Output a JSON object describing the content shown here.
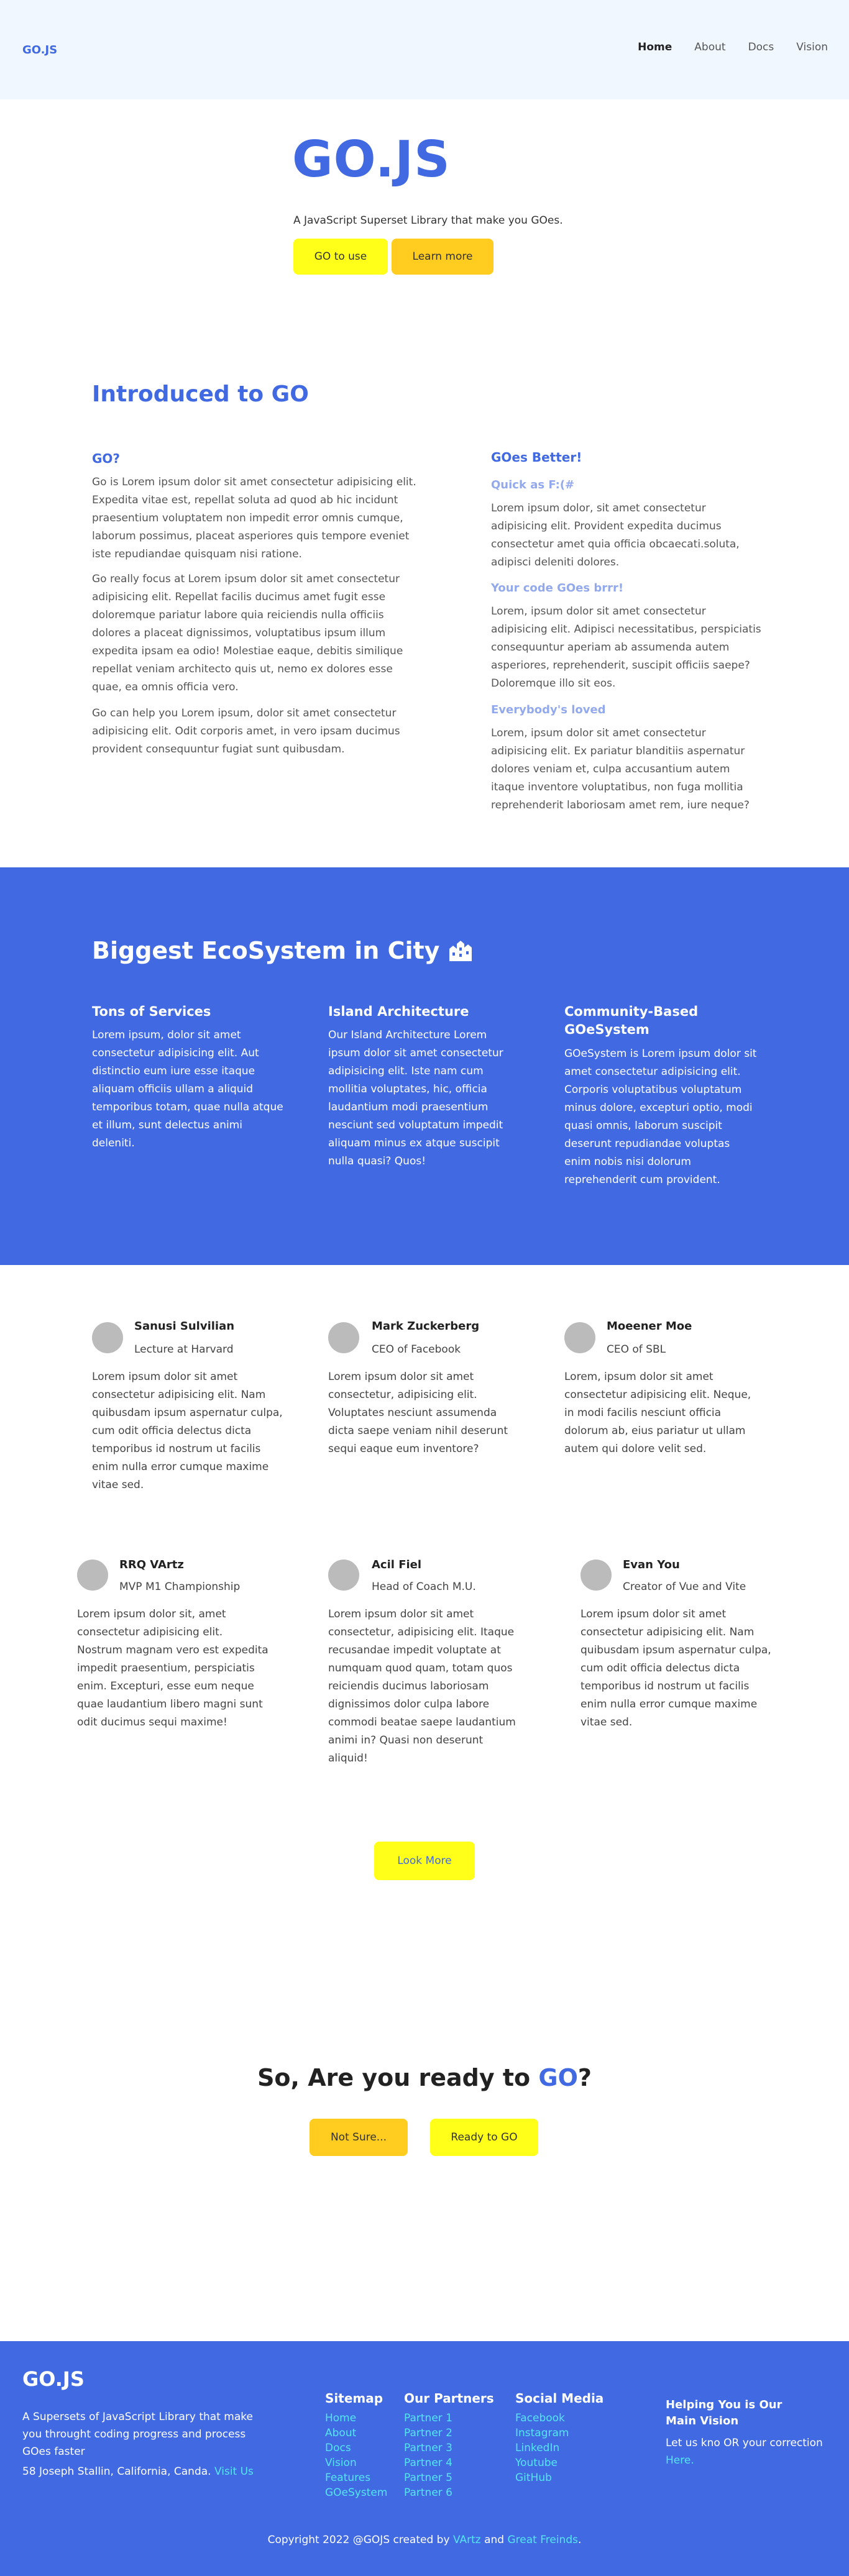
{
  "header": {
    "logo": "GO.JS",
    "nav": [
      "Home",
      "About",
      "Docs",
      "Vision"
    ]
  },
  "hero": {
    "title": "GO.JS",
    "subtitle": "A JavaScript Superset Library that make you GOes.",
    "btn_primary": "GO to use",
    "btn_secondary": "Learn more"
  },
  "intro": {
    "title": "Introduced to GO",
    "left_heading": "GO?",
    "left_paragraphs": [
      "Go is Lorem ipsum dolor sit amet consectetur adipisicing elit. Expedita vitae est, repellat soluta ad quod ab hic incidunt praesentium voluptatem non impedit error omnis cumque, laborum possimus, placeat asperiores quis tempore eveniet iste repudiandae quisquam nisi ratione.",
      "Go really focus at Lorem ipsum dolor sit amet consectetur adipisicing elit. Repellat facilis ducimus amet fugit esse doloremque pariatur labore quia reiciendis nulla officiis dolores a placeat dignissimos, voluptatibus ipsum illum expedita ipsam ea odio! Molestiae eaque, debitis similique repellat veniam architecto quis ut, nemo ex dolores esse quae, ea omnis officia vero.",
      "Go can help you Lorem ipsum, dolor sit amet consectetur adipisicing elit. Odit corporis amet, in vero ipsam ducimus provident consequuntur fugiat sunt quibusdam."
    ],
    "right_heading": "GOes Better!",
    "right_items": [
      {
        "title": "Quick as F:(#",
        "text": "Lorem ipsum dolor, sit amet consectetur adipisicing elit. Provident expedita ducimus consectetur amet quia officia obcaecati.soluta, adipisci deleniti dolores."
      },
      {
        "title": "Your code GOes brrr!",
        "text": "Lorem, ipsum dolor sit amet consectetur adipisicing elit. Adipisci necessitatibus, perspiciatis consequuntur aperiam ab assumenda autem asperiores, reprehenderit, suscipit officiis saepe? Doloremque illo sit eos."
      },
      {
        "title": "Everybody's loved",
        "text": "Lorem, ipsum dolor sit amet consectetur adipisicing elit. Ex pariatur blanditiis aspernatur dolores veniam et, culpa accusantium autem itaque inventore voluptatibus, non fuga mollitia reprehenderit laboriosam amet rem, iure neque?"
      }
    ]
  },
  "ecosystem": {
    "title": "Biggest EcoSystem in City",
    "icon": "city-icon",
    "columns": [
      {
        "title": "Tons of Services",
        "text": "Lorem ipsum, dolor sit amet consectetur adipisicing elit. Aut distinctio eum iure esse itaque aliquam officiis ullam a aliquid temporibus totam, quae nulla atque et illum, sunt delectus animi deleniti."
      },
      {
        "title": "Island Architecture",
        "text": "Our Island Architecture Lorem ipsum dolor sit amet consectetur adipisicing elit. Iste nam cum mollitia voluptates, hic, officia laudantium modi praesentium nesciunt sed voluptatum impedit aliquam minus ex atque suscipit nulla quasi? Quos!"
      },
      {
        "title": "Community-Based GOeSystem",
        "text": "GOeSystem is Lorem ipsum dolor sit amet consectetur adipisicing elit. Corporis voluptatibus voluptatum minus dolore, excepturi optio, modi quasi omnis, laborum suscipit deserunt repudiandae voluptas enim nobis nisi dolorum reprehenderit cum provident."
      }
    ]
  },
  "testimonials": [
    {
      "name": "Sanusi Sulvilian",
      "role": "Lecture at Harvard",
      "text": "Lorem ipsum dolor sit amet consectetur adipisicing elit. Nam quibusdam ipsum aspernatur culpa, cum odit officia delectus dicta temporibus id nostrum ut facilis enim nulla error cumque maxime vitae sed."
    },
    {
      "name": "Mark Zuckerberg",
      "role": "CEO of Facebook",
      "text": "Lorem ipsum dolor sit amet consectetur, adipisicing elit. Voluptates nesciunt assumenda dicta saepe veniam nihil deserunt sequi eaque eum inventore?"
    },
    {
      "name": "Moeener Moe",
      "role": "CEO of SBL",
      "text": "Lorem, ipsum dolor sit amet consectetur adipisicing elit. Neque, in modi facilis nesciunt officia dolorum ab, eius pariatur ut ullam autem qui dolore velit sed."
    },
    {
      "name": "RRQ VArtz",
      "role": "MVP M1 Championship",
      "text": "Lorem ipsum dolor sit, amet consectetur adipisicing elit. Nostrum magnam vero est expedita impedit praesentium, perspiciatis enim. Excepturi, esse eum neque quae laudantium libero magni sunt odit ducimus sequi maxime!"
    },
    {
      "name": "Acil Fiel",
      "role": "Head of Coach M.U.",
      "text": "Lorem ipsum dolor sit amet consectetur, adipisicing elit. Itaque recusandae impedit voluptate at numquam quod quam, totam quos reiciendis ducimus laboriosam dignissimos dolor culpa labore commodi beatae saepe laudantium animi in? Quasi non deserunt aliquid!"
    },
    {
      "name": "Evan You",
      "role": "Creator of Vue and Vite",
      "text": "Lorem ipsum dolor sit amet consectetur adipisicing elit. Nam quibusdam ipsum aspernatur culpa, cum odit officia delectus dicta temporibus id nostrum ut facilis enim nulla error cumque maxime vitae sed."
    }
  ],
  "look_more": "Look More",
  "cta": {
    "title_prefix": "So, Are you ready to ",
    "title_go": "GO",
    "title_suffix": "?",
    "btn_not_sure": "Not Sure...",
    "btn_ready": "Ready to GO"
  },
  "footer": {
    "logo": "GO.JS",
    "description": "A Supersets of JavaScript Library that make you throught coding progress and process GOes faster",
    "address": "58 Joseph Stallin, California, Canda.",
    "visit": "Visit Us",
    "sitemap_title": "Sitemap",
    "sitemap": [
      "Home",
      "About",
      "Docs",
      "Vision",
      "Features",
      "GOeSystem"
    ],
    "partners_title": "Our Partners",
    "partners": [
      "Partner 1",
      "Partner 2",
      "Partner 3",
      "Partner 4",
      "Partner 5",
      "Partner 6"
    ],
    "social_title": "Social Media",
    "social": [
      "Facebook",
      "Instagram",
      "LinkedIn",
      "Youtube",
      "GitHub"
    ],
    "help_title": "Helping You is Our Main Vision",
    "help_text": "Let us kno OR your correction",
    "help_link": "Here.",
    "copyright_prefix": "Copyright 2022 @GOJS created by ",
    "copyright_author": "VArtz",
    "copyright_and": " and ",
    "copyright_friends": "Great Freinds",
    "copyright_end": "."
  }
}
